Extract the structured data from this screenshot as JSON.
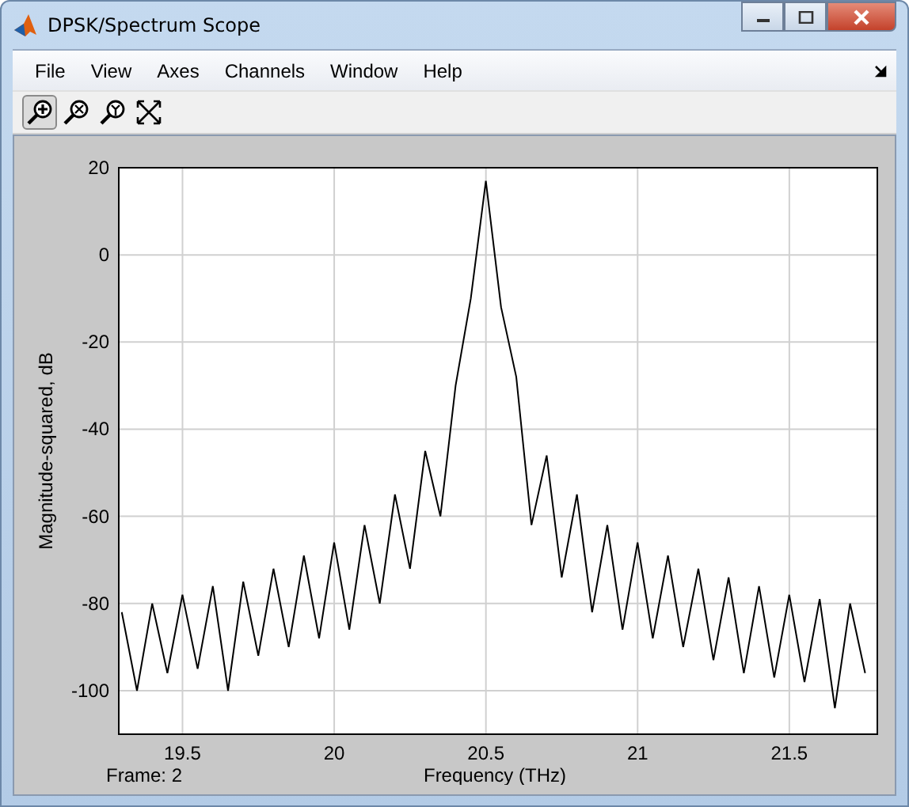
{
  "window": {
    "title": "DPSK/Spectrum Scope"
  },
  "menu": [
    "File",
    "View",
    "Axes",
    "Channels",
    "Window",
    "Help"
  ],
  "toolbar": [
    {
      "selected": true
    },
    {
      "selected": false
    },
    {
      "selected": false
    },
    {
      "selected": false
    }
  ],
  "scope": {
    "frame_label": "Frame: 2",
    "chart_data": {
      "type": "line",
      "grid": true,
      "xlabel": "Frequency (THz)",
      "ylabel": "Magnitude-squared, dB",
      "xlim": [
        19.29,
        21.79
      ],
      "ylim": [
        -110,
        20
      ],
      "xticks": [
        19.5,
        20,
        20.5,
        21,
        21.5
      ],
      "yticks": [
        20,
        0,
        -20,
        -40,
        -60,
        -80,
        -100
      ],
      "x": [
        19.3,
        19.35,
        19.4,
        19.45,
        19.5,
        19.55,
        19.6,
        19.65,
        19.7,
        19.75,
        19.8,
        19.85,
        19.9,
        19.95,
        20.0,
        20.05,
        20.1,
        20.15,
        20.2,
        20.25,
        20.3,
        20.35,
        20.4,
        20.45,
        20.5,
        20.55,
        20.6,
        20.65,
        20.7,
        20.75,
        20.8,
        20.85,
        20.9,
        20.95,
        21.0,
        21.05,
        21.1,
        21.15,
        21.2,
        21.25,
        21.3,
        21.35,
        21.4,
        21.45,
        21.5,
        21.55,
        21.6,
        21.65,
        21.7,
        21.75
      ],
      "series": [
        {
          "color": "#000000",
          "values": [
            -82,
            -100,
            -80,
            -96,
            -78,
            -95,
            -76,
            -100,
            -75,
            -92,
            -72,
            -90,
            -69,
            -88,
            -66,
            -86,
            -62,
            -80,
            -55,
            -72,
            -45,
            -60,
            -30,
            -10,
            17,
            -12,
            -28,
            -62,
            -46,
            -74,
            -55,
            -82,
            -62,
            -86,
            -66,
            -88,
            -69,
            -90,
            -72,
            -93,
            -74,
            -96,
            -76,
            -97,
            -78,
            -98,
            -79,
            -104,
            -80,
            -96
          ]
        }
      ]
    }
  }
}
